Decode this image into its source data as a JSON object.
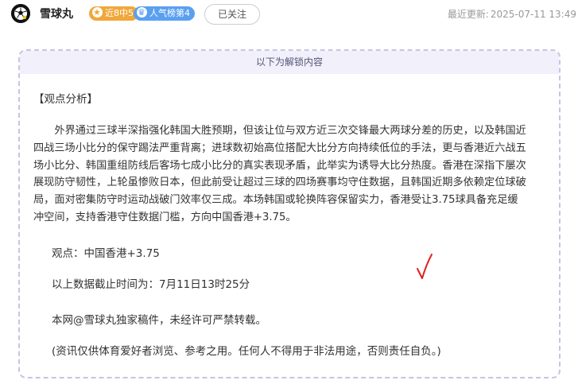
{
  "header": {
    "username": "雪球丸",
    "badge_record": "近8中5",
    "badge_rank": "人气榜第4",
    "follow_label": "已关注",
    "updated_label": "最近更新:",
    "updated_time": "2025-07-11 13:49"
  },
  "card": {
    "unlock_notice": "以下为解锁内容",
    "heading": "【观点分析】",
    "analysis": "外界通过三球半深指强化韩国大胜预期，但该让位与双方近三次交锋最大两球分差的历史，以及韩国近四战三场小比分的保守踢法严重背离；进球数初始高位搭配大比分方向持续低位的手法，更与香港近六战五场小比分、韩国重组防线后客场七成小比分的真实表现矛盾，此举实为诱导大比分热度。香港在深指下屡次展现防守韧性，上轮虽惨败日本，但此前受让超过三球的四场赛事均守住数据，且韩国近期多依赖定位球破局，面对密集防守时运动战破门效率仅三成。本场韩国或轮换阵容保留实力，香港受让3.75球具备充足缓冲空间，支持香港守住数据门槛，方向中国香港+3.75。",
    "view": "观点：中国香港+3.75",
    "cutoff": "以上数据截止时间为：7月11日13时25分",
    "copyright": "本网@雪球丸独家稿件，未经许可严禁转载。",
    "disclaimer": "(资讯仅供体育爱好者浏览、参考之用。任何人不得用于非法用途，否则责任自负。)"
  },
  "icons": {
    "avatar": "soccer-ball-avatar",
    "record_badge_icon": "star-icon",
    "rank_badge_icon": "crown-icon",
    "check_mark": "red-check-mark"
  },
  "colors": {
    "record_badge": "#f0a83a",
    "rank_badge": "#5aa0f0",
    "card_border": "#c7c4e6",
    "card_header_bg": "#f1f0fb",
    "check_mark": "#e02020"
  }
}
